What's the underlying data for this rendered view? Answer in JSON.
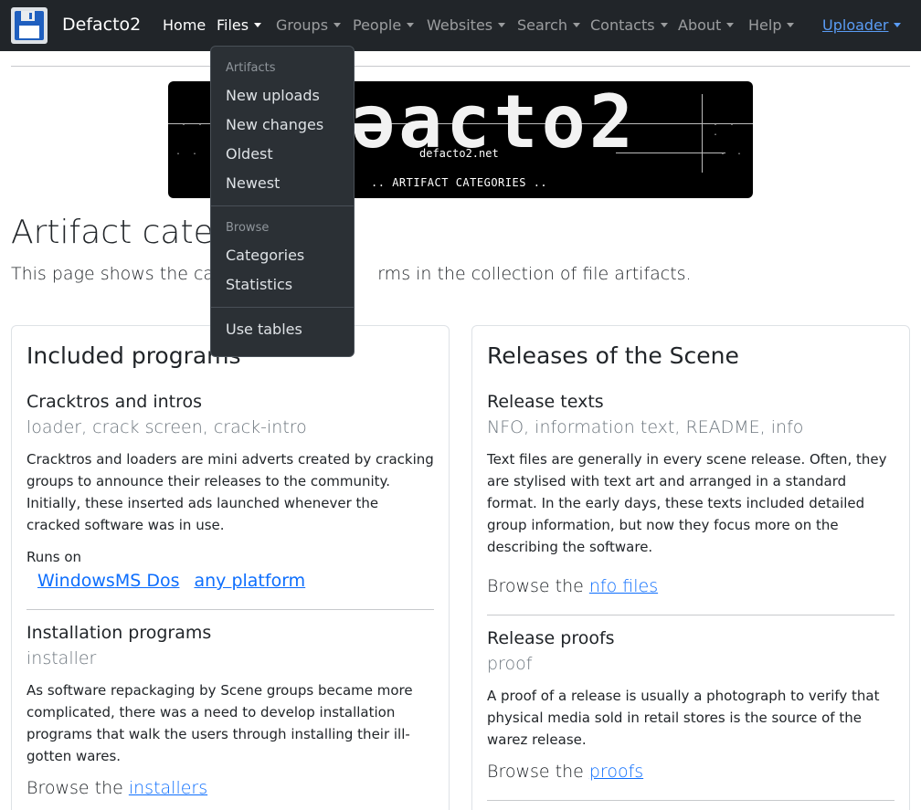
{
  "navbar": {
    "brand": "Defacto2",
    "items": [
      {
        "label": "Home"
      },
      {
        "label": "Files"
      },
      {
        "label": "Groups"
      },
      {
        "label": "People"
      },
      {
        "label": "Websites"
      },
      {
        "label": "Search"
      },
      {
        "label": "Contacts"
      },
      {
        "label": "About"
      },
      {
        "label": "Help"
      }
    ],
    "uploader": "Uploader"
  },
  "banner": {
    "logo": "ǝacto2",
    "site": "defacto2.net",
    "caption": "ARTIFACT CATEGORIES"
  },
  "header": {
    "title": "Artifact categ",
    "lead": "This page shows the cate",
    "lead_tail": "rms in the collection of file artifacts."
  },
  "dropdown": {
    "header_artifacts": "Artifacts",
    "artifacts": [
      "New uploads",
      "New changes",
      "Oldest",
      "Newest"
    ],
    "header_browse": "Browse",
    "browse": [
      "Categories",
      "Statistics"
    ],
    "tables": "Use tables"
  },
  "left_card": {
    "title": "Included programs",
    "sections": [
      {
        "title": "Cracktros and intros",
        "aliases": "loader, crack screen, crack-intro",
        "desc": "Cracktros and loaders are mini adverts created by cracking groups to announce their releases to the community. Initially, these inserted ads launched whenever the cracked software was in use.",
        "runs_label": "Runs on",
        "platforms": [
          "Windows",
          "MS Dos",
          "any platform"
        ]
      },
      {
        "title": "Installation programs",
        "aliases": "installer",
        "desc": "As software repackaging by Scene groups became more complicated, there was a need to develop installation programs that walk the users through installing their ill-gotten wares.",
        "browse_prefix": "Browse the ",
        "browse_link": "installers"
      }
    ]
  },
  "right_card": {
    "title": "Releases of the Scene",
    "sections": [
      {
        "title": "Release texts",
        "aliases": "NFO, information text, README, info",
        "desc": "Text files are generally in every scene release. Often, they are stylised with text art and arranged in a standard format. In the early days, these texts included detailed group information, but now they focus more on the describing the software.",
        "browse_prefix": "Browse the ",
        "browse_link": "nfo files"
      },
      {
        "title": "Release proofs",
        "aliases": "proof",
        "desc": "A proof of a release is usually a photograph to verify that physical media sold in retail stores is the source of the warez release.",
        "browse_prefix": "Browse the ",
        "browse_link": "proofs"
      }
    ]
  }
}
